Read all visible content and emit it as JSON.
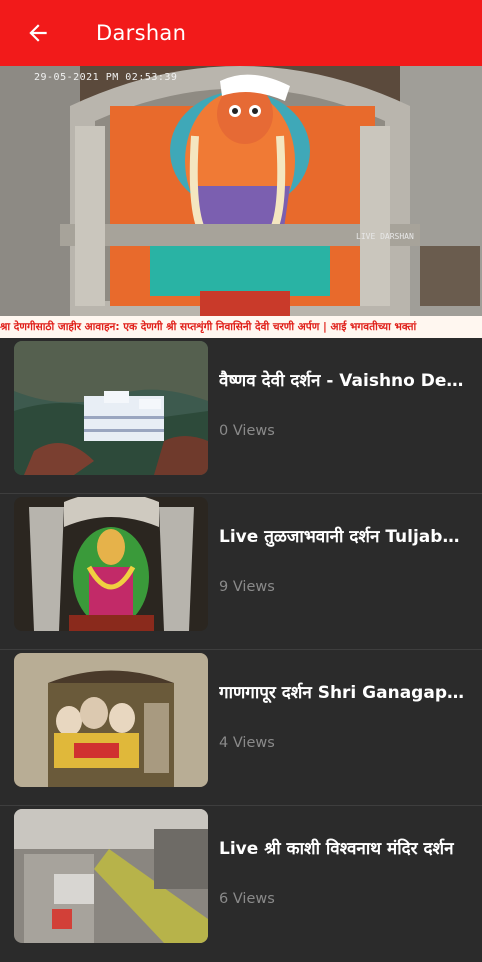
{
  "appbar": {
    "title": "Darshan",
    "back_icon": "arrow-left-icon",
    "color": "#f21a1a"
  },
  "player": {
    "timestamp": "29-05-2021 PM 02:53:39",
    "overlay_label": "LIVE DARSHAN",
    "ticker": "श्रा देणगीसाठी जाहीर आवाहन: एक देणगी श्री सप्तशृंगी निवासिनी देवी चरणी अर्पण | आई भगवतीच्या भक्तां"
  },
  "videos": [
    {
      "title": "वैष्णव देवी दर्शन - Vaishno Devi Darshan",
      "views": "0 Views"
    },
    {
      "title": "Live  तुळजाभवानी दर्शन Tuljabhavani Darshan",
      "views": "9 Views"
    },
    {
      "title": "गाणगापूर दर्शन Shri Ganagapur Darshan",
      "views": "4 Views"
    },
    {
      "title": "Live  श्री काशी विश्वनाथ मंदिर दर्शन",
      "views": "6 Views"
    }
  ]
}
